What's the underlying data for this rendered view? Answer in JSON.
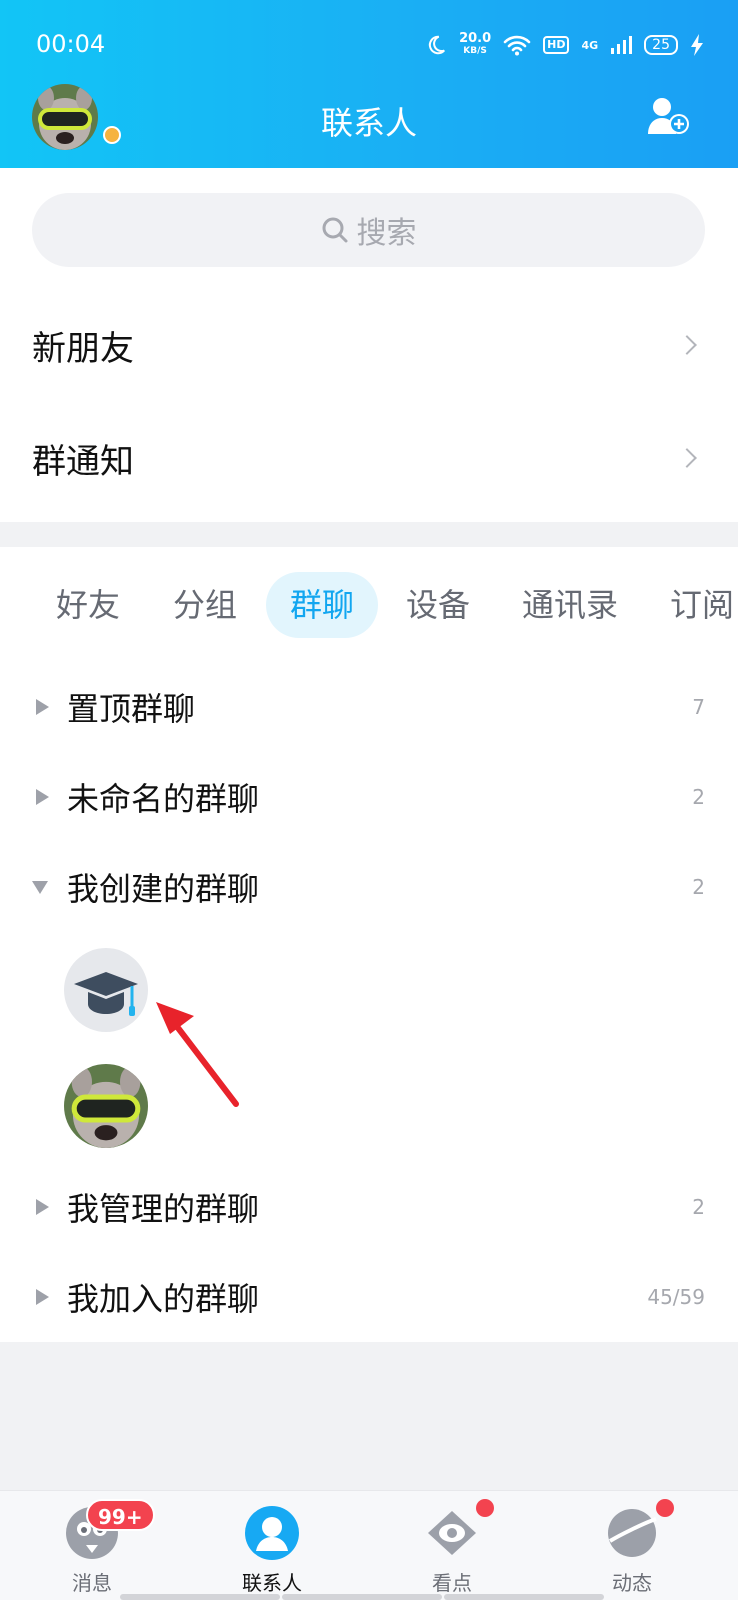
{
  "status_bar": {
    "time": "00:04",
    "speed": "20.0",
    "speed_unit": "KB/S",
    "hd": "HD",
    "network": "4G",
    "battery": "25"
  },
  "header": {
    "title": "联系人"
  },
  "search": {
    "placeholder": "搜索"
  },
  "menu_rows": [
    {
      "label": "新朋友"
    },
    {
      "label": "群通知"
    }
  ],
  "tabs": [
    {
      "label": "好友"
    },
    {
      "label": "分组"
    },
    {
      "label": "群聊"
    },
    {
      "label": "设备"
    },
    {
      "label": "通讯录"
    },
    {
      "label": "订阅"
    }
  ],
  "active_tab": "群聊",
  "groups": [
    {
      "name": "置顶群聊",
      "count": "7",
      "expanded": false
    },
    {
      "name": "未命名的群聊",
      "count": "2",
      "expanded": false
    },
    {
      "name": "我创建的群聊",
      "count": "2",
      "expanded": true
    },
    {
      "name": "我管理的群聊",
      "count": "2",
      "expanded": false
    },
    {
      "name": "我加入的群聊",
      "count": "45/59",
      "expanded": false
    }
  ],
  "created_group_items": [
    {
      "icon": "graduation-cap-icon"
    },
    {
      "icon": "dog-goggles-avatar"
    }
  ],
  "bottom_nav": [
    {
      "label": "消息",
      "badge": "99+"
    },
    {
      "label": "联系人"
    },
    {
      "label": "看点"
    },
    {
      "label": "动态"
    }
  ],
  "colors": {
    "header_start": "#12c5f6",
    "header_end": "#1a9ff4",
    "accent": "#12a6f0",
    "badge_red": "#f3434f"
  }
}
